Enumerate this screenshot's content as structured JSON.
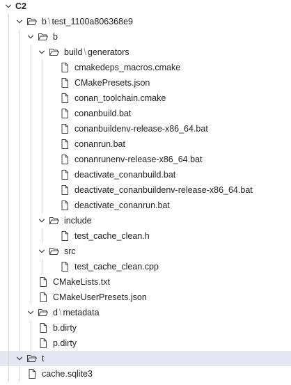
{
  "tree": {
    "root_label": "C2",
    "items": [
      {
        "segments": [
          "b",
          "test_1100a806368e9"
        ],
        "type": "folder",
        "level": 1,
        "expanded": true,
        "name": "folder-b-test"
      },
      {
        "segments": [
          "b"
        ],
        "type": "folder",
        "level": 2,
        "expanded": true,
        "name": "folder-b"
      },
      {
        "segments": [
          "build",
          "generators"
        ],
        "type": "folder",
        "level": 3,
        "expanded": true,
        "name": "folder-build-generators"
      },
      {
        "segments": [
          "cmakedeps_macros.cmake"
        ],
        "type": "file",
        "level": 4,
        "name": "file-cmakedeps-macros"
      },
      {
        "segments": [
          "CMakePresets.json"
        ],
        "type": "file",
        "level": 4,
        "name": "file-cmakepresets-json"
      },
      {
        "segments": [
          "conan_toolchain.cmake"
        ],
        "type": "file",
        "level": 4,
        "name": "file-conan-toolchain"
      },
      {
        "segments": [
          "conanbuild.bat"
        ],
        "type": "file",
        "level": 4,
        "name": "file-conanbuild-bat"
      },
      {
        "segments": [
          "conanbuildenv-release-x86_64.bat"
        ],
        "type": "file",
        "level": 4,
        "name": "file-conanbuildenv-release"
      },
      {
        "segments": [
          "conanrun.bat"
        ],
        "type": "file",
        "level": 4,
        "name": "file-conanrun-bat"
      },
      {
        "segments": [
          "conanrunenv-release-x86_64.bat"
        ],
        "type": "file",
        "level": 4,
        "name": "file-conanrunenv-release"
      },
      {
        "segments": [
          "deactivate_conanbuild.bat"
        ],
        "type": "file",
        "level": 4,
        "name": "file-deactivate-conanbuild"
      },
      {
        "segments": [
          "deactivate_conanbuildenv-release-x86_64.bat"
        ],
        "type": "file",
        "level": 4,
        "name": "file-deactivate-conanbuildenv"
      },
      {
        "segments": [
          "deactivate_conanrun.bat"
        ],
        "type": "file",
        "level": 4,
        "name": "file-deactivate-conanrun"
      },
      {
        "segments": [
          "include"
        ],
        "type": "folder",
        "level": 3,
        "expanded": true,
        "name": "folder-include"
      },
      {
        "segments": [
          "test_cache_clean.h"
        ],
        "type": "file",
        "level": 4,
        "name": "file-test-cache-clean-h"
      },
      {
        "segments": [
          "src"
        ],
        "type": "folder",
        "level": 3,
        "expanded": true,
        "name": "folder-src"
      },
      {
        "segments": [
          "test_cache_clean.cpp"
        ],
        "type": "file",
        "level": 4,
        "name": "file-test-cache-clean-cpp"
      },
      {
        "segments": [
          "CMakeLists.txt"
        ],
        "type": "file",
        "level": 3,
        "name": "file-cmakelists"
      },
      {
        "segments": [
          "CMakeUserPresets.json"
        ],
        "type": "file",
        "level": 3,
        "name": "file-cmakeuserpresets"
      },
      {
        "segments": [
          "d",
          "metadata"
        ],
        "type": "folder",
        "level": 2,
        "expanded": true,
        "name": "folder-d-metadata"
      },
      {
        "segments": [
          "b.dirty"
        ],
        "type": "file",
        "level": 3,
        "name": "file-b-dirty"
      },
      {
        "segments": [
          "p.dirty"
        ],
        "type": "file",
        "level": 3,
        "name": "file-p-dirty"
      },
      {
        "segments": [
          "t"
        ],
        "type": "folder",
        "level": 1,
        "expanded": true,
        "selected": true,
        "name": "folder-t"
      },
      {
        "segments": [
          "cache.sqlite3"
        ],
        "type": "file",
        "level": 2,
        "name": "file-cache-sqlite3"
      }
    ]
  },
  "icons": {
    "chevron": "chevron-down-icon",
    "folder": "folder-open-icon",
    "file": "file-icon"
  },
  "colors": {
    "selection": "#e4e6f1",
    "guide": "#d6d6d6",
    "icon_stroke": "#424242",
    "text": "#1f1f1f",
    "separator": "#8a8a8a"
  }
}
